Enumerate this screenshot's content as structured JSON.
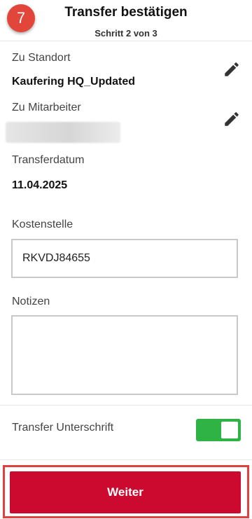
{
  "header": {
    "step_number": "7",
    "title": "Transfer bestätigen",
    "subtitle": "Schritt 2 von 3"
  },
  "fields": {
    "location_label": "Zu Standort",
    "location_value": "Kaufering HQ_Updated",
    "employee_label": "Zu Mitarbeiter",
    "date_label": "Transferdatum",
    "date_value": "11.04.2025",
    "cost_center_label": "Kostenstelle",
    "cost_center_value": "RKVDJ84655",
    "notes_label": "Notizen",
    "notes_value": "",
    "signature_label": "Transfer Unterschrift",
    "signature_enabled": true
  },
  "footer": {
    "continue_label": "Weiter"
  },
  "icons": {
    "edit": "pencil-icon"
  },
  "colors": {
    "accent": "#cc0a2f",
    "badge": "#e2453a",
    "toggle_on": "#2fb344",
    "highlight": "#e04040"
  }
}
